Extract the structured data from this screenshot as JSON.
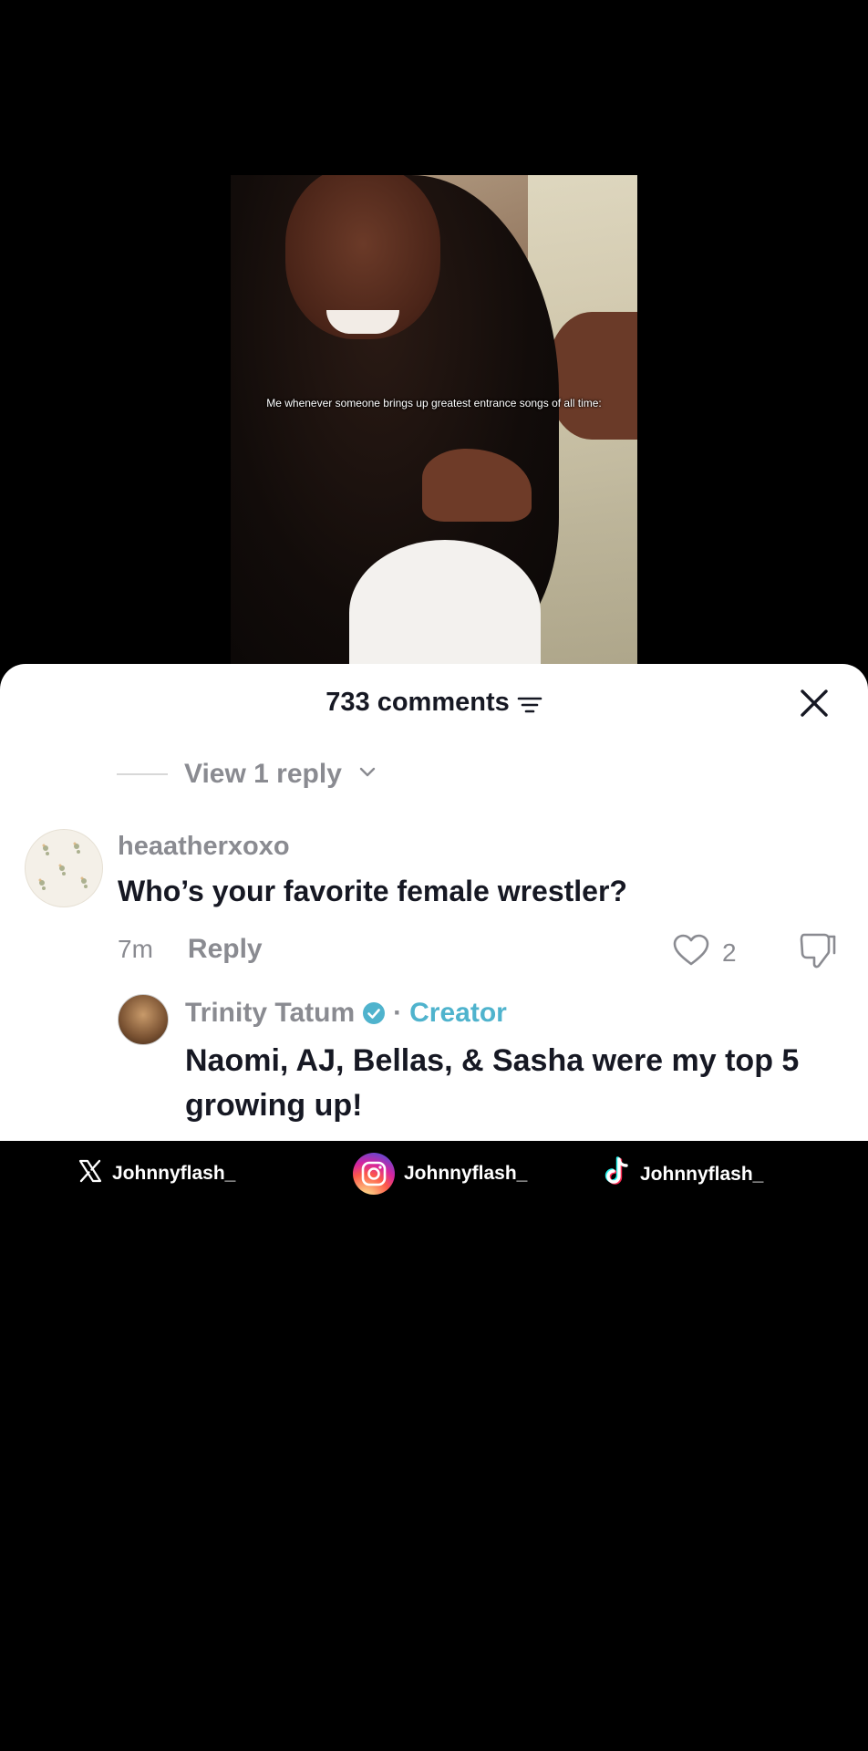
{
  "video": {
    "caption": "Me whenever someone brings up greatest entrance songs of all time:"
  },
  "comments_sheet": {
    "title": "733 comments",
    "filter_icon": "filter-lines-icon",
    "close_icon": "close-icon",
    "view_replies_label": "View 1 reply",
    "view_replies_chevron": "chevron-down-icon",
    "comment": {
      "username": "heaatherxoxo",
      "text": "Who’s your favorite female wrestler?",
      "timestamp": "7m",
      "reply_label": "Reply",
      "like_count": "2",
      "like_icon": "heart-outline-icon",
      "dislike_icon": "thumbs-down-icon"
    },
    "reply": {
      "username": "Trinity Tatum",
      "verified_icon": "verified-badge-icon",
      "separator": "·",
      "badge": "Creator",
      "text": "Naomi, AJ, Bellas, & Sasha were my top 5 growing up!"
    }
  },
  "socials": {
    "x_handle": "Johnnyflash_",
    "instagram_handle": "Johnnyflash_",
    "tiktok_handle": "Johnnyflash_"
  },
  "colors": {
    "background": "#000000",
    "sheet": "#ffffff",
    "text_primary": "#161823",
    "text_secondary": "#8a8b91",
    "creator_accent": "#4fb3cd"
  }
}
